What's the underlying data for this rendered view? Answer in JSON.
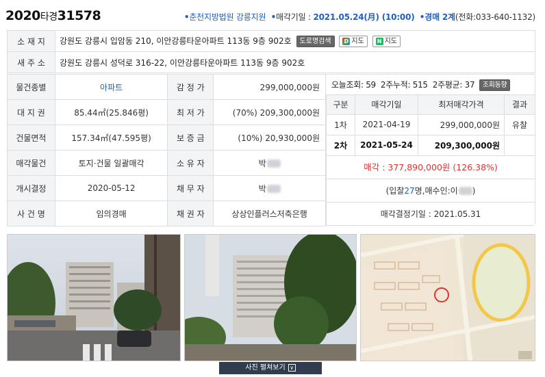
{
  "header": {
    "case_year": "2020",
    "case_type": "타경",
    "case_num": "31578",
    "court": "춘천지방법원 강릉지원",
    "sale_date_label": "매각기일 : ",
    "sale_date": "2021.05.24(月) (10:00)",
    "dept": "경매 2계",
    "phone": "(전화:033-640-1132)"
  },
  "address": {
    "lot_label": "소 재 지",
    "lot_value": "강원도 강릉시 입암동 210, 이안강릉타운아파트 113동 9층 902호",
    "btn_road": "도로명검색",
    "btn_daum": "지도",
    "btn_naver": "지도",
    "road_label": "새 주 소",
    "road_value": "강원도 강릉시 성덕로 316-22, 이안강릉타운아파트 113동 9층 902호",
    "daum_icon": "D",
    "naver_icon": "N"
  },
  "details": {
    "r1": {
      "l1": "물건종별",
      "v1": "아파트",
      "l2": "감 정 가",
      "v2": "299,000,000원"
    },
    "r2": {
      "l1": "대 지 권",
      "v1": "85.44㎡(25.846평)",
      "l2": "최 저 가",
      "v2": "(70%) 209,300,000원"
    },
    "r3": {
      "l1": "건물면적",
      "v1": "157.34㎡(47.595평)",
      "l2": "보 증 금",
      "v2": "(10%) 20,930,000원"
    },
    "r4": {
      "l1": "매각물건",
      "v1": "토지·건물 일괄매각",
      "l2": "소 유 자",
      "v2": "박"
    },
    "r5": {
      "l1": "개시결정",
      "v1": "2020-05-12",
      "l2": "채 무 자",
      "v2": "박"
    },
    "r6": {
      "l1": "사 건 명",
      "v1": "임의경매",
      "l2": "채 권 자",
      "v2": "상상인플러스저축은행"
    }
  },
  "views": {
    "today_label": "오늘조회: ",
    "today": "59",
    "two_week_label": "2주누적: ",
    "two_week": "515",
    "avg_label": "2주평균: ",
    "avg": "37",
    "trend_btn": "조회동향"
  },
  "rounds": {
    "headers": [
      "구분",
      "매각기일",
      "최저매각가격",
      "결과"
    ],
    "rows": [
      {
        "round": "1차",
        "date": "2021-04-19",
        "price": "299,000,000원",
        "result": "유찰"
      },
      {
        "round": "2차",
        "date": "2021-05-24",
        "price": "209,300,000원",
        "result": ""
      }
    ]
  },
  "result": {
    "sale_label": "매각 : ",
    "sale_price": "377,890,000원",
    "sale_pct": "(126.38%)",
    "bid_prefix": "(입찰",
    "bid_count": "27",
    "bid_suffix": "명,매수인:이",
    "bid_end": ")",
    "decision": "매각결정기일 : 2021.05.31"
  },
  "photos": {
    "toggle_label": "사진 펼쳐보기",
    "toggle_icon": "∨"
  }
}
